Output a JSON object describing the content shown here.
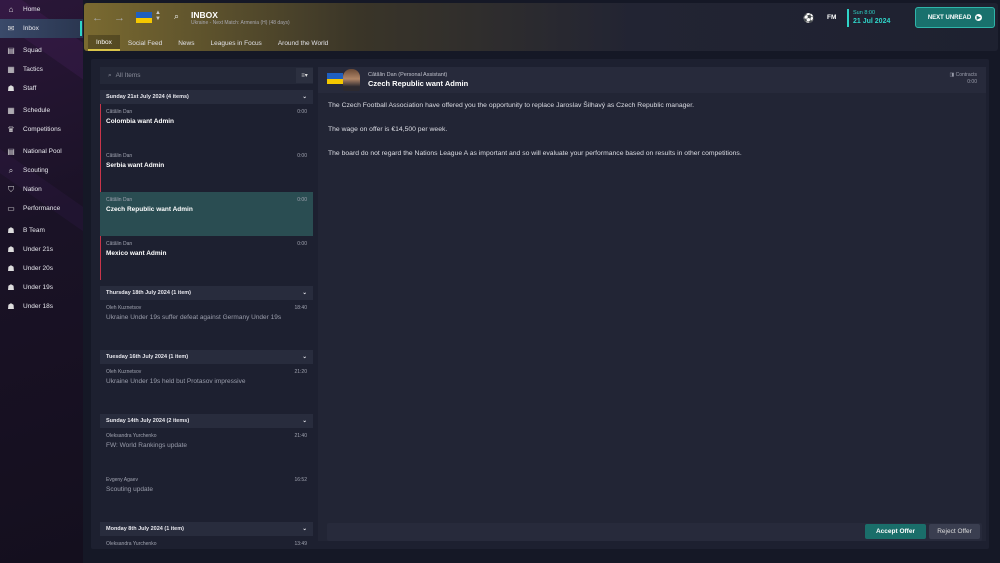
{
  "sidebar": {
    "items": [
      {
        "label": "Home",
        "icon": "home-icon",
        "glyph": "⌂",
        "active": false
      },
      {
        "label": "Inbox",
        "icon": "inbox-icon",
        "glyph": "✉",
        "active": true
      },
      {
        "label": "Squad",
        "icon": "squad-icon",
        "glyph": "▤",
        "active": false
      },
      {
        "label": "Tactics",
        "icon": "tactics-icon",
        "glyph": "▦",
        "active": false
      },
      {
        "label": "Staff",
        "icon": "staff-icon",
        "glyph": "☗",
        "active": false
      },
      {
        "label": "Schedule",
        "icon": "schedule-icon",
        "glyph": "▦",
        "active": false
      },
      {
        "label": "Competitions",
        "icon": "trophy-icon",
        "glyph": "♛",
        "active": false
      },
      {
        "label": "National Pool",
        "icon": "national-pool-icon",
        "glyph": "▤",
        "active": false
      },
      {
        "label": "Scouting",
        "icon": "scouting-icon",
        "glyph": "⌕",
        "active": false
      },
      {
        "label": "Nation",
        "icon": "nation-icon",
        "glyph": "⛉",
        "active": false
      },
      {
        "label": "Performance",
        "icon": "performance-icon",
        "glyph": "▭",
        "active": false
      },
      {
        "label": "B Team",
        "icon": "b-team-icon",
        "glyph": "☗",
        "active": false
      },
      {
        "label": "Under 21s",
        "icon": "under-21s-icon",
        "glyph": "☗",
        "active": false
      },
      {
        "label": "Under 20s",
        "icon": "under-20s-icon",
        "glyph": "☗",
        "active": false
      },
      {
        "label": "Under 19s",
        "icon": "under-19s-icon",
        "glyph": "☗",
        "active": false
      },
      {
        "label": "Under 18s",
        "icon": "under-18s-icon",
        "glyph": "☗",
        "active": false
      }
    ]
  },
  "header": {
    "title": "INBOX",
    "subtitle": "Ukraine - Next Match: Armenia (H) (48 days)",
    "tabs": [
      "Inbox",
      "Social Feed",
      "News",
      "Leagues in Focus",
      "Around the World"
    ],
    "brand": "FM",
    "time": "Sun 8:00",
    "date": "21 Jul 2024",
    "next_unread": "NEXT UNREAD"
  },
  "list": {
    "search_placeholder": "All Items",
    "groups": [
      {
        "label": "Sunday 21st July 2024 (4 items)",
        "messages": [
          {
            "from": "Cătălin Dan",
            "time": "0:00",
            "subject": "Colombia want Admin",
            "unread": true,
            "selected": false
          },
          {
            "from": "Cătălin Dan",
            "time": "0:00",
            "subject": "Serbia want Admin",
            "unread": true,
            "selected": false
          },
          {
            "from": "Cătălin Dan",
            "time": "0:00",
            "subject": "Czech Republic want Admin",
            "unread": false,
            "selected": true
          },
          {
            "from": "Cătălin Dan",
            "time": "0:00",
            "subject": "Mexico want Admin",
            "unread": true,
            "selected": false
          }
        ]
      },
      {
        "label": "Thursday 18th July 2024 (1 item)",
        "messages": [
          {
            "from": "Oleh Kuznetsov",
            "time": "18:40",
            "subject": "Ukraine Under 19s suffer defeat against Germany Under 19s",
            "read": true
          }
        ]
      },
      {
        "label": "Tuesday 16th July 2024 (1 item)",
        "messages": [
          {
            "from": "Oleh Kuznetsov",
            "time": "21:20",
            "subject": "Ukraine Under 19s held but Protasov impressive",
            "read": true
          }
        ]
      },
      {
        "label": "Sunday 14th July 2024 (2 items)",
        "messages": [
          {
            "from": "Oleksandra Yurchenko",
            "time": "21:40",
            "subject": "FW: World Rankings update",
            "read": true
          },
          {
            "from": "Evgeny Agaev",
            "time": "16:52",
            "subject": "Scouting update",
            "read": true
          }
        ]
      },
      {
        "label": "Monday 8th July 2024 (1 item)",
        "messages": [
          {
            "from": "Oleksandra Yurchenko",
            "time": "13:49",
            "subject": "",
            "read": true
          }
        ]
      }
    ]
  },
  "detail": {
    "sender": "Cătălin Dan  (Personal Assistant)",
    "subject": "Czech Republic want Admin",
    "contracts_label": "Contracts",
    "contracts_value": "0:00",
    "body": [
      "The Czech Football Association have offered you the opportunity to replace Jaroslav Šilhavý as Czech Republic manager.",
      "The wage on offer is €14,500 per week.",
      "The board do not regard the Nations League A as important and so will evaluate your performance based on results in other competitions."
    ],
    "accept": "Accept Offer",
    "reject": "Reject Offer"
  },
  "colors": {
    "accent": "#2fd4c8",
    "unread_marker": "#c8354a",
    "flag_blue": "#1f5fbf",
    "flag_yellow": "#f5c800"
  }
}
